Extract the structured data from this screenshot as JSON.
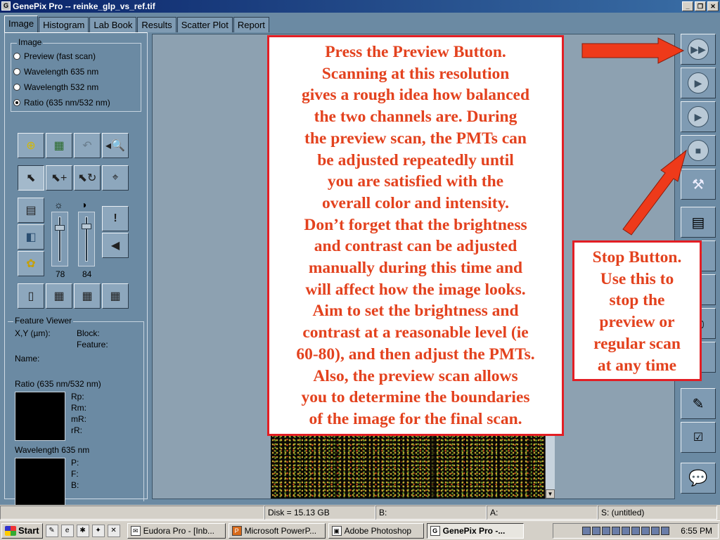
{
  "window": {
    "title": "GenePix Pro -- reinke_glp_vs_ref.tif",
    "controls": [
      "_",
      "❐",
      "✕"
    ]
  },
  "tabs": [
    "Image",
    "Histogram",
    "Lab Book",
    "Results",
    "Scatter Plot",
    "Report"
  ],
  "image_group": {
    "title": "Image",
    "options": [
      "Preview  (fast scan)",
      "Wavelength 635 nm",
      "Wavelength 532 nm",
      "Ratio (635 nm/532 nm)"
    ],
    "selected": "Ratio (635 nm/532 nm)"
  },
  "sliders": {
    "brightness": 78,
    "contrast": 84
  },
  "feature_viewer": {
    "title": "Feature Viewer",
    "xy": "X,Y (µm):",
    "block": "Block:",
    "feature": "Feature:",
    "name": "Name:",
    "ratio_title": "Ratio (635 nm/532 nm)",
    "ratio_labels": [
      "Rp:",
      "Rm:",
      "mR:",
      "rR:"
    ],
    "wl_title": "Wavelength 635 nm",
    "wl_labels": [
      "P:",
      "F:",
      "B:"
    ]
  },
  "callout_main": [
    "Press the Preview Button.",
    "Scanning at this resolution",
    "gives a rough idea how balanced",
    "the two channels are.  During",
    "the preview scan, the PMTs can",
    "be adjusted repeatedly until",
    "you are satisfied with the",
    "overall color and intensity.",
    "Don’t forget that the brightness",
    "and contrast can be adjusted",
    "manually during this time and",
    "will affect how the image looks.",
    "Aim to set the brightness and",
    "contrast at a reasonable level (ie",
    "60-80), and then adjust the PMTs.",
    "Also, the preview scan allows",
    "you to determine the boundaries",
    "of the image for the final scan."
  ],
  "callout_side": [
    "Stop Button.",
    "Use this to",
    "stop the",
    "preview or",
    "regular scan",
    "at any time"
  ],
  "status": {
    "disk": "Disk = 15.13 GB",
    "b": "B:",
    "a": "A:",
    "s": "S: (untitled)"
  },
  "taskbar": {
    "start": "Start",
    "tasks": [
      "Eudora Pro - [Inb...",
      "Microsoft PowerP...",
      "Adobe Photoshop",
      "GenePix Pro -..."
    ],
    "active": 3,
    "clock": "6:55 PM"
  },
  "colors": {
    "accent_red": "#e31e24",
    "text_red": "#e3421e",
    "panel": "#6b8aa3"
  }
}
